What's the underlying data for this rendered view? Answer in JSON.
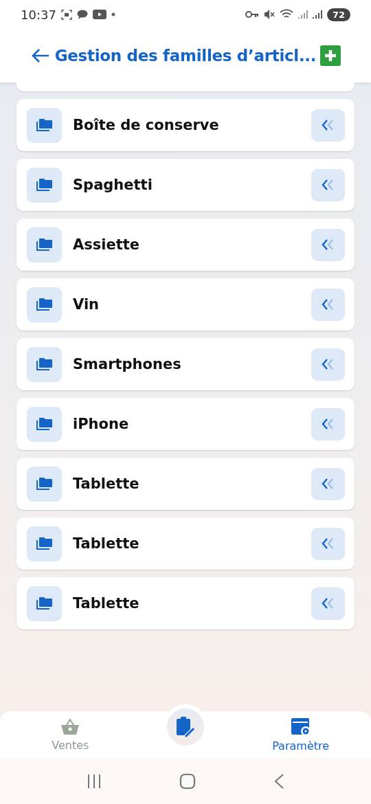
{
  "status_bar": {
    "time": "10:37",
    "battery": "72"
  },
  "header": {
    "title": "Gestion des familles d’articl..."
  },
  "families": [
    {
      "name": "Boîte de conserve"
    },
    {
      "name": "Spaghetti"
    },
    {
      "name": "Assiette"
    },
    {
      "name": "Vin"
    },
    {
      "name": "Smartphones"
    },
    {
      "name": "iPhone"
    },
    {
      "name": "Tablette"
    },
    {
      "name": "Tablette"
    },
    {
      "name": "Tablette"
    }
  ],
  "bottom_nav": [
    {
      "label": "Ventes",
      "kind": "basket",
      "selected": false
    },
    {
      "kind": "center"
    },
    {
      "label": "Paramètre",
      "kind": "settings",
      "selected": true
    }
  ]
}
